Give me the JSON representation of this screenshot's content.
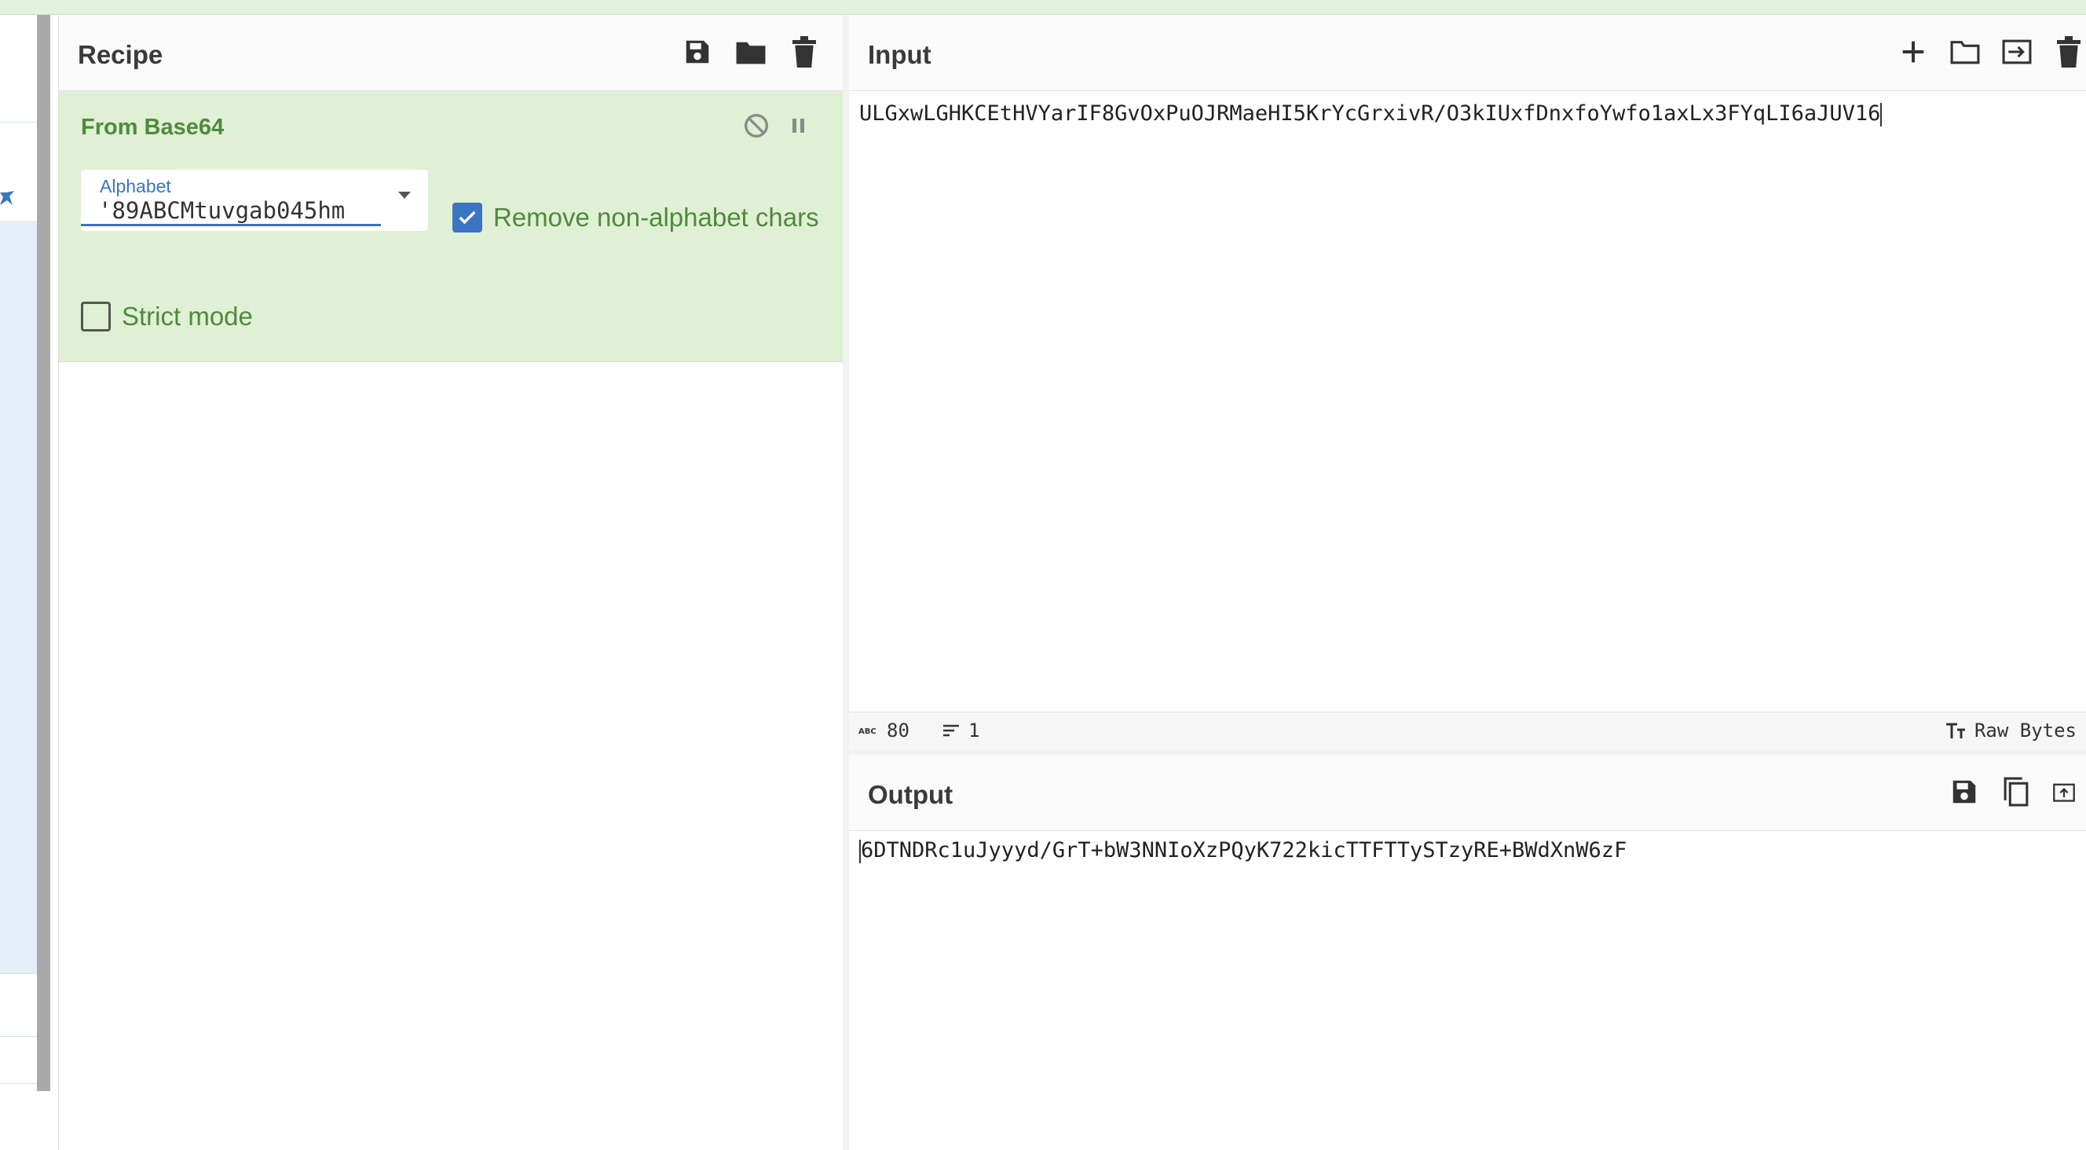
{
  "recipe": {
    "title": "Recipe",
    "icons": [
      "save-icon",
      "folder-icon",
      "trash-icon"
    ],
    "operation": {
      "name": "From Base64",
      "alphabet_label": "Alphabet",
      "alphabet_value": "'89ABCMtuvgab045hm",
      "remove_non_alphabet_label": "Remove non-alphabet chars",
      "remove_non_alphabet_checked": true,
      "strict_mode_label": "Strict mode",
      "strict_mode_checked": false
    }
  },
  "input": {
    "title": "Input",
    "text": "ULGxwLGHKCEtHVYarIF8GvOxPuOJRMaeHI5KrYcGrxivR/O3kIUxfDnxfoYwfo1axLx3FYqLI6aJUV16",
    "status": {
      "length": "80",
      "lines": "1",
      "encoding": "Raw Bytes"
    }
  },
  "output": {
    "title": "Output",
    "text": "6DTNDRc1uJyyyd/GrT+bW3NNIoXzPQyK722kicTTFTTySTzyRE+BWdXnW6zF"
  },
  "colors": {
    "accent": "#3a74c4",
    "op_bg": "#dff0d4",
    "op_text": "#4f8a3e",
    "topbar": "#e3f1dd"
  }
}
